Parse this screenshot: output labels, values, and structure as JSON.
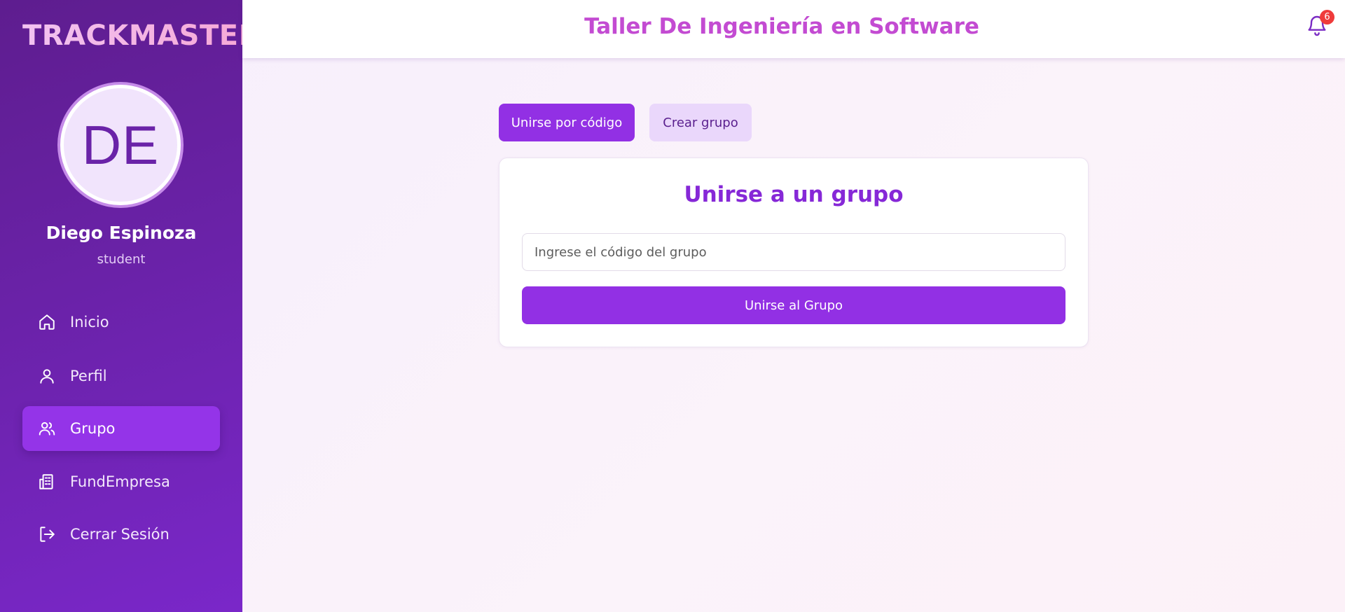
{
  "sidebar": {
    "brand": "TRACKMASTER",
    "avatar_initials": "DE",
    "user_name": "Diego Espinoza",
    "user_role": "student",
    "items": [
      {
        "label": "Inicio",
        "icon": "home-icon"
      },
      {
        "label": "Perfil",
        "icon": "user-icon"
      },
      {
        "label": "Grupo",
        "icon": "users-icon",
        "active": true
      },
      {
        "label": "FundEmpresa",
        "icon": "building-icon"
      },
      {
        "label": "Cerrar Sesión",
        "icon": "logout-icon"
      }
    ]
  },
  "header": {
    "title": "Taller De Ingeniería en Software",
    "notification_count": "6"
  },
  "tabs": {
    "join_label": "Unirse por código",
    "create_label": "Crear grupo"
  },
  "card": {
    "title": "Unirse a un grupo",
    "input_placeholder": "Ingrese el código del grupo",
    "input_value": "",
    "button_label": "Unirse al Grupo"
  },
  "colors": {
    "sidebar": "#6a22a8",
    "accent": "#9230e4",
    "title": "#c34bd2",
    "badge": "#ef3b3b"
  }
}
